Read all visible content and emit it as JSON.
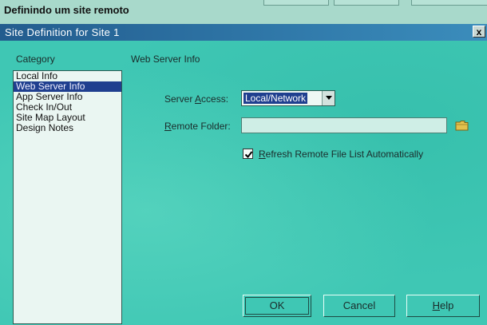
{
  "page_heading": "Definindo um site remoto",
  "window": {
    "title": "Site Definition for Site 1",
    "close_label": "x"
  },
  "category": {
    "label": "Category",
    "items": [
      "Local Info",
      "Web Server Info",
      "App Server Info",
      "Check In/Out",
      "Site Map Layout",
      "Design Notes"
    ],
    "selected": "Web Server Info"
  },
  "panel": {
    "heading": "Web Server Info",
    "server_access": {
      "label_pre": "Server ",
      "label_key": "A",
      "label_post": "ccess:",
      "value": "Local/Network"
    },
    "remote_folder": {
      "label_key": "R",
      "label_post": "emote Folder:",
      "value": ""
    },
    "refresh": {
      "checked": true,
      "label_key": "R",
      "label_post": "efresh Remote File List Automatically"
    }
  },
  "buttons": {
    "ok": "OK",
    "cancel": "Cancel",
    "help_key": "H",
    "help_post": "elp"
  },
  "colors": {
    "dialog_bg": "#3fc7b4",
    "selection": "#1f3f8f",
    "titlebar": "#2f77a8"
  },
  "icons": {
    "folder": "folder-icon",
    "dropdown": "chevron-down-icon",
    "close": "close-icon",
    "check": "check-icon"
  }
}
